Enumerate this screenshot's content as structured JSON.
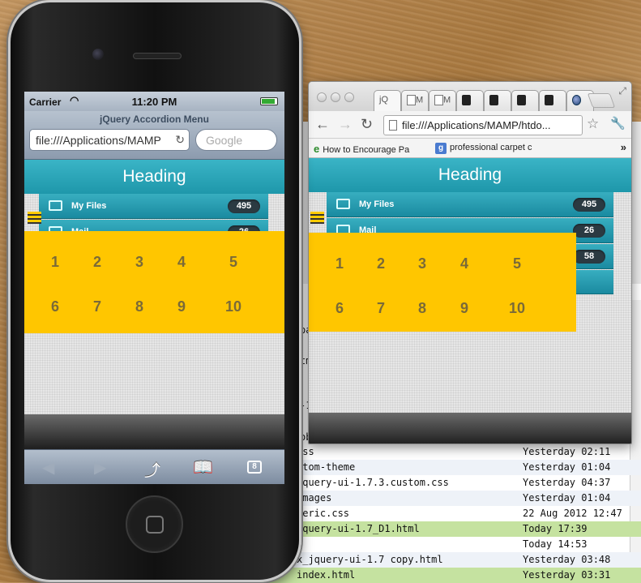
{
  "finder": {
    "fragments": [
      "pa",
      "tm",
      "-1",
      "ob",
      "ca"
    ],
    "rows": [
      {
        "name": "css",
        "date": "Yesterday 02:11",
        "style": ""
      },
      {
        "name": "stom-theme",
        "date": "Yesterday 01:04",
        "style": "alt"
      },
      {
        "name": "jquery-ui-1.7.3.custom.css",
        "date": "Yesterday 04:37",
        "style": ""
      },
      {
        "name": "images",
        "date": "Yesterday 01:04",
        "style": "alt"
      },
      {
        "name": "neric.css",
        "date": "22 Aug 2012 12:47",
        "style": ""
      },
      {
        "name": "jquery-ui-1.7_D1.html",
        "date": "Today 17:39",
        "style": "hl"
      },
      {
        "name": "s",
        "date": "Today 14:53",
        "style": ""
      },
      {
        "name": "x_jquery-ui-1.7 copy.html",
        "date": "Yesterday 03:48",
        "style": "alt"
      },
      {
        "name": "index.html",
        "date": "Yesterday 03:31",
        "style": "hl"
      }
    ]
  },
  "chrome": {
    "tabs": [
      {
        "label": "jQ",
        "icon": "tab-doc-icon"
      },
      {
        "label": "M",
        "icon": "tab-doc-icon"
      },
      {
        "label": "M",
        "icon": "tab-doc-icon"
      },
      {
        "label": "",
        "icon": "pirate-favicon-icon"
      },
      {
        "label": "",
        "icon": "pirate-favicon-icon"
      },
      {
        "label": "",
        "icon": "pirate-favicon-icon"
      },
      {
        "label": "",
        "icon": "pirate-favicon-icon"
      },
      {
        "label": "",
        "icon": "globe-favicon-icon"
      }
    ],
    "url": "file:///Applications/MAMP/htdo...",
    "bookmarks": [
      {
        "label": "How to Encourage Pa",
        "icon": "ie-icon"
      },
      {
        "label": "professional carpet c",
        "icon": "google-icon"
      }
    ],
    "more": "»"
  },
  "app": {
    "heading": "Heading",
    "items": [
      {
        "label": "My Files",
        "count": "495"
      },
      {
        "label": "Mail",
        "count": "26"
      },
      {
        "label": "",
        "count": "58"
      }
    ],
    "numbers_row1": [
      "1",
      "2",
      "3",
      "4",
      "5"
    ],
    "numbers_row2": [
      "6",
      "7",
      "8",
      "9",
      "10"
    ]
  },
  "iphone": {
    "carrier": "Carrier",
    "time": "11:20 PM",
    "page_title": "jQuery Accordion Menu",
    "url": "file:///Applications/MAMP",
    "search_placeholder": "Google",
    "tabs_count": "8"
  },
  "colors": {
    "accent": "#1e97aa",
    "overlay": "#ffc600",
    "finder_highlight": "#c5e2a0"
  }
}
